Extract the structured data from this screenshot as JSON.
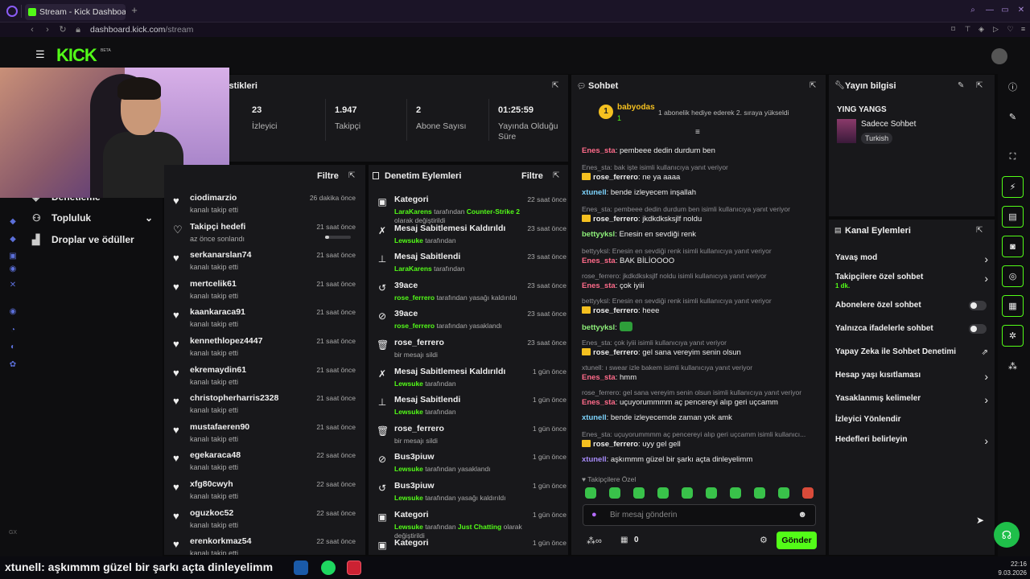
{
  "browser": {
    "tab_title": "Stream - Kick Dashboard",
    "new_tab": "+",
    "url_host": "dashboard.kick.com",
    "url_path": "/stream"
  },
  "header": {
    "brand": "KICK",
    "beta": "BETA"
  },
  "left_nav": {
    "items": [
      {
        "label": "Denetleme",
        "icon": "shield-icon"
      },
      {
        "label": "Topluluk",
        "icon": "community-icon"
      },
      {
        "label": "Droplar ve ödüller",
        "icon": "drops-icon"
      }
    ],
    "rail_icons": [
      "home-icon",
      "chart-icon",
      "video-icon",
      "circle-icon",
      "x-icon",
      "circle-icon",
      "clock-icon",
      "discord-icon",
      "settings-icon"
    ]
  },
  "stats_panel": {
    "title": "Oturum İstatistikleri",
    "stats": [
      {
        "value": "23",
        "label": "İzleyici"
      },
      {
        "value": "1.947",
        "label": "Takipçi"
      },
      {
        "value": "2",
        "label": "Abone Sayısı"
      },
      {
        "value": "01:25:59",
        "label": "Yayında Olduğu Süre"
      }
    ]
  },
  "followers_panel": {
    "filter_label": "Filtre",
    "rows": [
      {
        "name": "ciodimarzio",
        "sub": "kanalı takip etti",
        "time": "26 dakika önce"
      },
      {
        "name": "Takipçi hedefi",
        "sub": "az önce sonlandı",
        "time": "21 saat önce",
        "progress": 0.15
      },
      {
        "name": "serkanarslan74",
        "sub": "kanalı takip etti",
        "time": "21 saat önce"
      },
      {
        "name": "mertcelik61",
        "sub": "kanalı takip etti",
        "time": "21 saat önce"
      },
      {
        "name": "kaankaraca91",
        "sub": "kanalı takip etti",
        "time": "21 saat önce"
      },
      {
        "name": "kennethlopez4447",
        "sub": "kanalı takip etti",
        "time": "21 saat önce"
      },
      {
        "name": "ekremaydin61",
        "sub": "kanalı takip etti",
        "time": "21 saat önce"
      },
      {
        "name": "christopherharris2328",
        "sub": "kanalı takip etti",
        "time": "21 saat önce"
      },
      {
        "name": "mustafaeren90",
        "sub": "kanalı takip etti",
        "time": "21 saat önce"
      },
      {
        "name": "egekaraca48",
        "sub": "kanalı takip etti",
        "time": "22 saat önce"
      },
      {
        "name": "xfg80cwyh",
        "sub": "kanalı takip etti",
        "time": "22 saat önce"
      },
      {
        "name": "oguzkoc52",
        "sub": "kanalı takip etti",
        "time": "22 saat önce"
      },
      {
        "name": "erenkorkmaz54",
        "sub": "kanalı takip etti",
        "time": "22 saat önce"
      }
    ]
  },
  "moderation_panel": {
    "title": "Denetim Eylemleri",
    "filter_label": "Filtre",
    "rows": [
      {
        "icon": "category-icon",
        "title": "Kategori",
        "actor": "LaraKarens",
        "mid": " tarafından ",
        "target": "Counter-Strike 2",
        "rest": " olarak değiştirildi",
        "time": "22 saat önce"
      },
      {
        "icon": "unpin-icon",
        "title": "Mesaj Sabitlemesi Kaldırıldı",
        "actor": "Lewsuke",
        "mid": " tarafından",
        "target": "",
        "rest": "",
        "time": "23 saat önce"
      },
      {
        "icon": "pin-icon",
        "title": "Mesaj Sabitlendi",
        "actor": "LaraKarens",
        "mid": " tarafından",
        "target": "",
        "rest": "",
        "time": "23 saat önce"
      },
      {
        "icon": "undo-icon",
        "title": "39ace",
        "actor": "rose_ferrero",
        "mid": " tarafından yasağı kaldırıldı",
        "target": "",
        "rest": "",
        "time": "23 saat önce"
      },
      {
        "icon": "ban-icon",
        "title": "39ace",
        "actor": "rose_ferrero",
        "mid": " tarafından yasaklandı",
        "target": "",
        "rest": "",
        "time": "23 saat önce"
      },
      {
        "icon": "trash-icon",
        "title": "rose_ferrero",
        "actor": "",
        "mid": "bir mesajı sildi",
        "target": "",
        "rest": "",
        "time": "23 saat önce"
      },
      {
        "icon": "unpin-icon",
        "title": "Mesaj Sabitlemesi Kaldırıldı",
        "actor": "Lewsuke",
        "mid": " tarafından",
        "target": "",
        "rest": "",
        "time": "1 gün önce"
      },
      {
        "icon": "pin-icon",
        "title": "Mesaj Sabitlendi",
        "actor": "Lewsuke",
        "mid": " tarafından",
        "target": "",
        "rest": "",
        "time": "1 gün önce"
      },
      {
        "icon": "trash-icon",
        "title": "rose_ferrero",
        "actor": "",
        "mid": "bir mesajı sildi",
        "target": "",
        "rest": "",
        "time": "1 gün önce"
      },
      {
        "icon": "ban-icon",
        "title": "Bus3piuw",
        "actor": "Lewsuke",
        "mid": " tarafından yasaklandı",
        "target": "",
        "rest": "",
        "time": "1 gün önce"
      },
      {
        "icon": "undo-icon",
        "title": "Bus3piuw",
        "actor": "Lewsuke",
        "mid": " tarafından yasağı kaldırıldı",
        "target": "",
        "rest": "",
        "time": "1 gün önce"
      },
      {
        "icon": "category-icon",
        "title": "Kategori",
        "actor": "Lewsuke",
        "mid": " tarafından ",
        "target": "Just Chatting",
        "rest": " olarak değiştirildi",
        "time": "1 gün önce"
      },
      {
        "icon": "category-icon",
        "title": "Kategori",
        "actor": "",
        "mid": "",
        "target": "",
        "rest": "",
        "time": "1 gün önce"
      }
    ]
  },
  "chat_panel": {
    "title": "Sohbet",
    "pinned_user": "babyodas",
    "pinned_rank": "1",
    "pinned_count": "1",
    "pinned_text": "1 abonelik hediye ederek 2. sıraya yükseldi",
    "messages": [
      {
        "reply": "",
        "user": "Enes_sta",
        "color": "#ff6b8a",
        "crown": false,
        "text": ": pembeee dedin durdum ben"
      },
      {
        "reply": "Enes_sta: bak işte isimli kullanıcıya yanıt veriyor",
        "user": "rose_ferrero",
        "color": "#eeeeee",
        "crown": true,
        "text": ": ne ya aaaa"
      },
      {
        "reply": "",
        "user": "xtunell",
        "color": "#7dd3fc",
        "crown": false,
        "text": ": bende izleyecem inşallah"
      },
      {
        "reply": "Enes_sta: pembeee dedin durdum ben isimli kullanıcıya yanıt veriyor",
        "user": "rose_ferrero",
        "color": "#eeeeee",
        "crown": true,
        "text": ": jkdkdksksjlf noldu"
      },
      {
        "reply": "",
        "user": "bettyyksl",
        "color": "#8ef07a",
        "crown": false,
        "text": ": Enesin en sevdiği renk"
      },
      {
        "reply": "bettyyksl: Enesin en sevdiği renk isimli kullanıcıya yanıt veriyor",
        "user": "Enes_sta",
        "color": "#ff6b8a",
        "crown": false,
        "text": ": BAK BİLİOOOO"
      },
      {
        "reply": "rose_ferrero: jkdkdksksjlf noldu isimli kullanıcıya yanıt veriyor",
        "user": "Enes_sta",
        "color": "#ff6b8a",
        "crown": false,
        "text": ": çok iyiii"
      },
      {
        "reply": "bettyyksl: Enesin en sevdiği renk isimli kullanıcıya yanıt veriyor",
        "user": "rose_ferrero",
        "color": "#eeeeee",
        "crown": true,
        "text": ": heee"
      },
      {
        "reply": "",
        "user": "bettyyksl",
        "color": "#8ef07a",
        "crown": false,
        "text": ":",
        "emote": true
      },
      {
        "reply": "Enes_sta: çok iyiii isimli kullanıcıya yanıt veriyor",
        "user": "rose_ferrero",
        "color": "#eeeeee",
        "crown": true,
        "text": ": gel sana vereyim senin olsun"
      },
      {
        "reply": "xtunell: ı swear izle bakem isimli kullanıcıya yanıt veriyor",
        "user": "Enes_sta",
        "color": "#ff6b8a",
        "crown": false,
        "text": ": hmm"
      },
      {
        "reply": "rose_ferrero: gel sana vereyim senin olsun isimli kullanıcıya yanıt veriyor",
        "user": "Enes_sta",
        "color": "#ff6b8a",
        "crown": false,
        "text": ": uçuyorummmm aç pencereyi alıp geri uçcamm"
      },
      {
        "reply": "",
        "user": "xtunell",
        "color": "#7dd3fc",
        "crown": false,
        "text": ": bende izleyecemde zaman yok amk"
      },
      {
        "reply": "Enes_sta: uçuyorummmm aç pencereyi alıp geri uçcamm isimli kullanıcı...",
        "user": "rose_ferrero",
        "color": "#eeeeee",
        "crown": true,
        "text": ": uyy gel gell"
      },
      {
        "reply": "",
        "user": "xtunell",
        "color": "#a78bfa",
        "crown": false,
        "text": ": aşkımmm güzel bir şarkı açta dinleyelimm"
      }
    ],
    "followers_only_label": "Takipçilere Özel",
    "input_placeholder": "Bir mesaj gönderin",
    "points": "0",
    "send_label": "Gönder"
  },
  "stream_info": {
    "title": "Yayın bilgisi",
    "stream_title": "YING YANGS",
    "category": "Sadece Sohbet",
    "tag": "Turkish"
  },
  "channel_actions": {
    "title": "Kanal Eylemleri",
    "items": [
      {
        "label": "Yavaş mod",
        "control": "arrow"
      },
      {
        "label": "Takipçilere özel sohbet",
        "sub": "1 dk.",
        "control": "arrow"
      },
      {
        "label": "Abonelere özel sohbet",
        "control": "toggle"
      },
      {
        "label": "Yalnızca ifadelerle sohbet",
        "control": "toggle"
      },
      {
        "label": "Yapay Zeka ile Sohbet Denetimi",
        "control": "external"
      },
      {
        "label": "Hesap yaşı kısıtlaması",
        "control": "arrow"
      },
      {
        "label": "Yasaklanmış kelimeler",
        "control": "arrow"
      },
      {
        "label": "İzleyici Yönlendir",
        "control": "none"
      },
      {
        "label": "Hedefleri belirleyin",
        "control": "arrow"
      }
    ]
  },
  "right_rail": [
    "info-icon",
    "edit-icon",
    "fullscreen-icon",
    "lightning-icon",
    "notes-icon",
    "chat-icon",
    "broadcast-icon",
    "actions-icon",
    "wrench-icon",
    "apps-icon"
  ],
  "overlay_caption": "xtunell: aşkımmm güzel bir şarkı açta dinleyelimm",
  "clock": {
    "time": "22:16",
    "date": "9.03.2026"
  },
  "colors": {
    "accent": "#53fc18",
    "panel": "#18181b",
    "background": "#0e0e10"
  }
}
